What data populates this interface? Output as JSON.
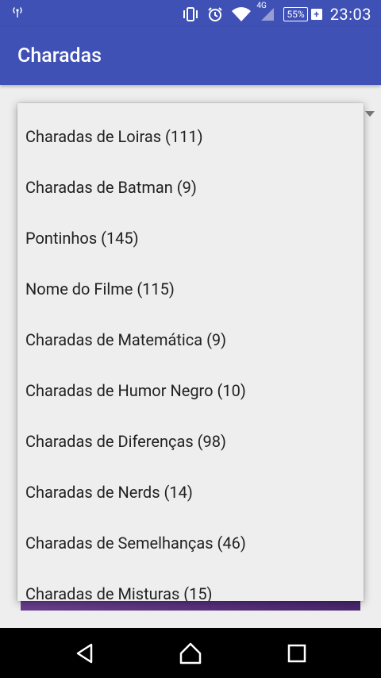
{
  "status_bar": {
    "battery_percent": "55%",
    "time": "23:03",
    "network": "4G"
  },
  "app_bar": {
    "title": "Charadas"
  },
  "dropdown": {
    "items": [
      "Charadas de Loiras (111)",
      "Charadas de Batman (9)",
      "Pontinhos (145)",
      "Nome do Filme (115)",
      "Charadas de Matemática (9)",
      "Charadas de Humor Negro (10)",
      "Charadas de Diferenças (98)",
      "Charadas de Nerds (14)",
      "Charadas de Semelhanças (46)",
      "Charadas de Misturas (15)"
    ]
  },
  "colors": {
    "primary": "#3f51b5",
    "background": "#eeeeee",
    "accent_bar": "#5a3380"
  }
}
